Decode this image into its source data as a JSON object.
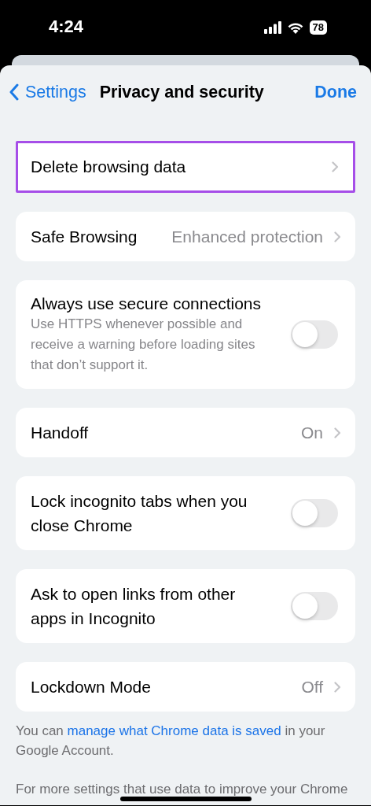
{
  "status_bar": {
    "time": "4:24",
    "battery": "78"
  },
  "nav": {
    "back": "Settings",
    "title": "Privacy and security",
    "done": "Done"
  },
  "items": [
    {
      "kind": "link",
      "label": "Delete browsing data",
      "highlighted": true
    },
    {
      "kind": "link",
      "label": "Safe Browsing",
      "value": "Enhanced protection",
      "highlighted": false
    },
    {
      "kind": "toggle",
      "label": "Always use secure connections",
      "description": "Use HTTPS whenever possible and receive a warning before loading sites that don’t support it.",
      "on": false
    },
    {
      "kind": "link",
      "label": "Handoff",
      "value": "On",
      "highlighted": false
    },
    {
      "kind": "toggle",
      "label": "Lock incognito tabs when you close Chrome",
      "on": false
    },
    {
      "kind": "toggle",
      "label": "Ask to open links from other apps in Incognito",
      "on": false
    },
    {
      "kind": "link",
      "label": "Lockdown Mode",
      "value": "Off",
      "highlighted": false
    }
  ],
  "footer": [
    {
      "before": "You can ",
      "link": "manage what Chrome data is saved",
      "after": " in your Google Account."
    },
    {
      "before": "For more settings that use data to improve your Chrome"
    }
  ]
}
